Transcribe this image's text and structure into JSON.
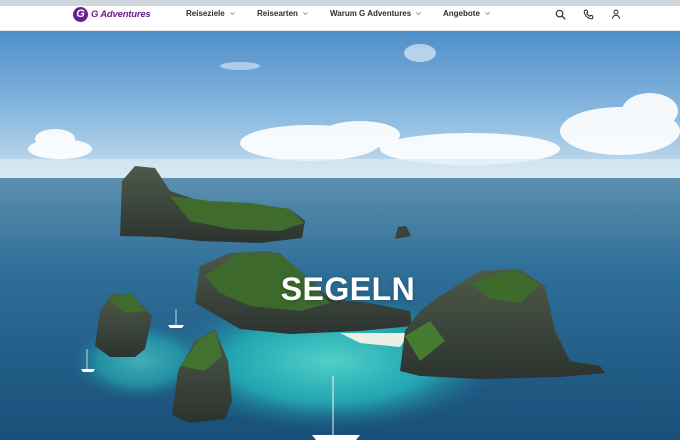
{
  "brand": {
    "name": "G Adventures",
    "logo_letter": "G",
    "color": "#6b1e8f"
  },
  "nav": {
    "items": [
      {
        "label": "Reiseziele"
      },
      {
        "label": "Reisearten"
      },
      {
        "label": "Warum G Adventures"
      },
      {
        "label": "Angebote"
      }
    ]
  },
  "actions": {
    "icons": [
      "search-icon",
      "phone-icon",
      "user-icon"
    ]
  },
  "hero": {
    "title": "SEGELN"
  }
}
